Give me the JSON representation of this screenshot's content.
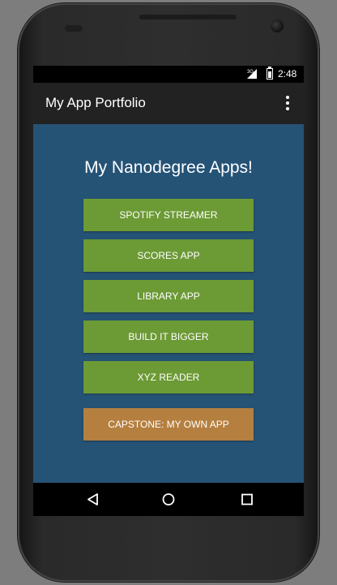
{
  "status_bar": {
    "network": "3G",
    "time": "2:48"
  },
  "app_bar": {
    "title": "My App Portfolio",
    "overflow_icon": "overflow-menu-icon"
  },
  "main": {
    "heading": "My Nanodegree Apps!",
    "buttons": [
      {
        "label": "SPOTIFY STREAMER"
      },
      {
        "label": "SCORES APP"
      },
      {
        "label": "LIBRARY APP"
      },
      {
        "label": "BUILD IT BIGGER"
      },
      {
        "label": "XYZ READER"
      },
      {
        "label": "CAPSTONE: MY OWN APP"
      }
    ]
  },
  "nav_bar": {
    "icons": [
      "back-icon",
      "home-icon",
      "recent-apps-icon"
    ]
  },
  "colors": {
    "content_background": "#255376",
    "app_button": "#6c9a35",
    "capstone_button": "#b57f3f",
    "app_bar": "#222222"
  }
}
